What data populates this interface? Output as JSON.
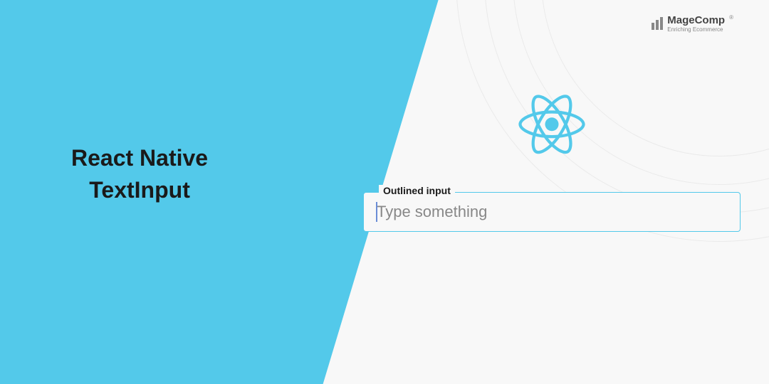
{
  "title": {
    "line1": "React Native",
    "line2": "TextInput"
  },
  "brand": {
    "name": "MageComp",
    "tagline": "Enriching Ecommerce"
  },
  "input": {
    "label": "Outlined input",
    "placeholder": "Type something",
    "value": ""
  },
  "colors": {
    "accent": "#53c9ea",
    "react_logo": "#61dafb"
  }
}
